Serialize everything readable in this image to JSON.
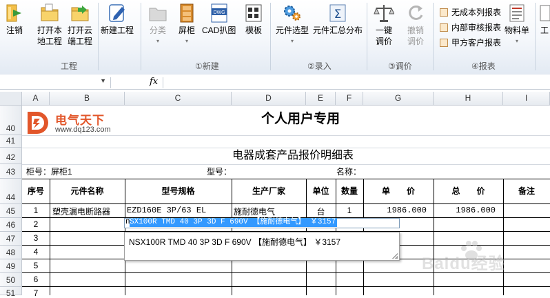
{
  "ribbon": {
    "buttons": [
      {
        "key": "logout",
        "label": "注销"
      },
      {
        "key": "open_local",
        "label": "打开本\n地工程"
      },
      {
        "key": "open_cloud",
        "label": "打开云\n端工程"
      },
      {
        "key": "new_project",
        "label": "新建工程"
      },
      {
        "key": "classify",
        "label": "分类"
      },
      {
        "key": "cabinet",
        "label": "屏柜"
      },
      {
        "key": "cad",
        "label": "CAD扒图"
      },
      {
        "key": "template",
        "label": "模板"
      },
      {
        "key": "component_select",
        "label": "元件选型"
      },
      {
        "key": "component_summary",
        "label": "元件汇总分布"
      },
      {
        "key": "oneclick_adjust",
        "label": "一键\n调价"
      },
      {
        "key": "undo_adjust",
        "label": "撤销\n调价"
      },
      {
        "key": "material_list",
        "label": "物料单"
      },
      {
        "key": "engineering",
        "label": "工"
      }
    ],
    "small_buttons": [
      "无成本列报表",
      "内部审核报表",
      "甲方客户报表"
    ],
    "groups": [
      "工程",
      "①新建",
      "②录入",
      "③调价",
      "④报表"
    ],
    "cad_badge": "DWG"
  },
  "formula_bar": {
    "fx_label": "fx",
    "name_box": ""
  },
  "columns": [
    "A",
    "B",
    "C",
    "D",
    "E",
    "F",
    "G",
    "H",
    "I"
  ],
  "rows": [
    "40",
    "41",
    "42",
    "43",
    "44",
    "45",
    "46",
    "47",
    "48",
    "49",
    "50",
    "51"
  ],
  "sheet": {
    "logo_text": "电气天下",
    "logo_url": "www.dq123.com",
    "title": "个人用户专用",
    "subtitle": "电器成套产品报价明细表",
    "cabinet_label": "柜号：屏柜1",
    "model_label": "型号：",
    "name_label": "名称：",
    "headers": [
      "序号",
      "元件名称",
      "型号规格",
      "生产厂家",
      "单位",
      "数量",
      "单　　价",
      "总　　价",
      "备注"
    ],
    "row1": {
      "no": "1",
      "name": "塑壳漏电断路器",
      "spec": "EZD160E 3P/63 EL",
      "maker": "施耐德电气",
      "unit": "台",
      "qty": "1",
      "price": "1986.000",
      "total": "1986.000"
    },
    "seq": [
      "2",
      "3",
      "4",
      "5",
      "6",
      "7"
    ]
  },
  "autocomplete": {
    "typed": "n",
    "selected": "SX100R TMD 40 3P 3D F 690V 【施耐德电气】 ￥3157",
    "option": "NSX100R TMD 40 3P 3D F 690V 【施耐德电气】 ￥3157"
  },
  "watermark": "Baidu经验"
}
